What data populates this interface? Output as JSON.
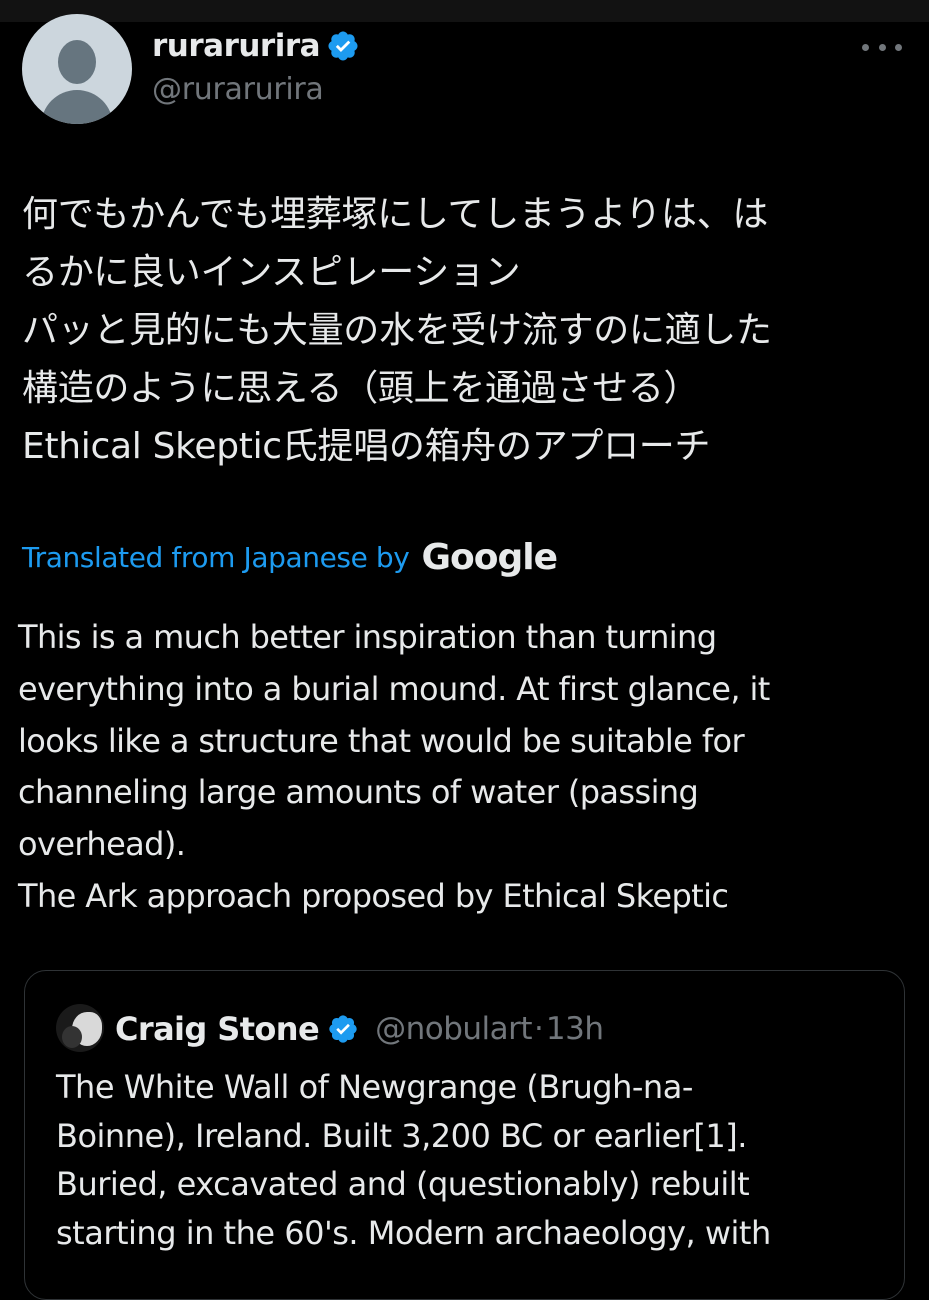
{
  "author": {
    "display_name": "rurarurira",
    "handle": "@rurarurira"
  },
  "post": {
    "original_lines": [
      "何でもかんでも埋葬塚にしてしまうよりは、は",
      "るかに良いインスピレーション",
      "パッと見的にも大量の水を受け流すのに適した",
      "構造のように思える（頭上を通過させる）",
      "Ethical Skeptic氏提唱の箱舟のアプローチ"
    ],
    "translated_label": "Translated from Japanese by",
    "translation_provider": "Google",
    "translation_lines": [
      "This is a much better inspiration than turning",
      "everything into a burial mound. At first glance, it",
      "looks like a structure that would be suitable for",
      "channeling large amounts of water (passing",
      "overhead).",
      "The Ark approach proposed by Ethical Skeptic"
    ]
  },
  "quoted_post": {
    "display_name": "Craig Stone",
    "handle": "@nobulart",
    "separator": "·",
    "time": "13h",
    "text_lines": [
      "The White Wall of Newgrange (Brugh-na-",
      "Boinne), Ireland. Built 3,200 BC or earlier[1].",
      "Buried, excavated and (questionably) rebuilt",
      "starting in the 60's. Modern archaeology, with",
      ""
    ]
  },
  "icons": {
    "avatar": "default-avatar-icon",
    "verified": "verified-badge-icon",
    "more": "more-options-icon"
  },
  "colors": {
    "background": "#000000",
    "text": "#e7e9ea",
    "secondary_text": "#71767b",
    "accent": "#1d9bf0",
    "border": "#2f3336"
  }
}
